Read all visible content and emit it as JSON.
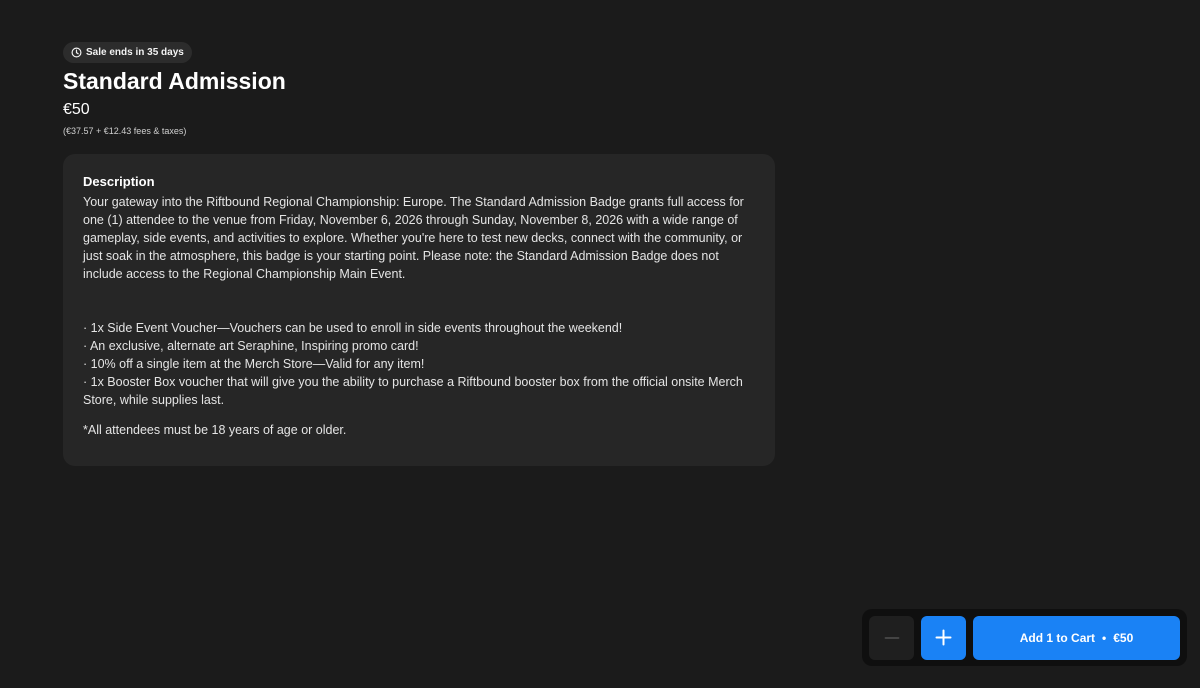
{
  "badge": {
    "sale_text": "Sale ends in 35 days",
    "icon": "clock-icon"
  },
  "ticket": {
    "title": "Standard Admission",
    "price": "€50",
    "fees": "(€37.57 + €12.43 fees & taxes)"
  },
  "description": {
    "heading": "Description",
    "paragraph": "Your gateway into the Riftbound Regional Championship: Europe. The Standard Admission Badge grants full access for one (1) attendee to the venue from Friday, November 6, 2026 through Sunday, November 8, 2026 with a wide range of gameplay, side events, and activities to explore. Whether you're here to test new decks, connect with the community, or just soak in the atmosphere, this badge is your starting point. Please note: the Standard Admission Badge does not include access to the Regional Championship Main Event.",
    "perks": [
      "· 1x Side Event Voucher—Vouchers can be used to enroll in side events throughout the weekend!",
      "· An exclusive, alternate art Seraphine, Inspiring promo card!",
      "· 10% off a single item at the Merch Store—Valid for any item!",
      "· 1x Booster Box voucher that will give you the ability to purchase a Riftbound booster box from the official onsite Merch Store, while supplies last."
    ],
    "age_note": "*All attendees must be 18 years of age or older."
  },
  "cart": {
    "minus_icon": "minus-icon",
    "plus_icon": "plus-icon",
    "add_label": "Add 1 to Cart",
    "separator": "•",
    "add_price": "€50"
  },
  "colors": {
    "background": "#1b1b1b",
    "card": "#262626",
    "accent": "#1a82f5"
  }
}
